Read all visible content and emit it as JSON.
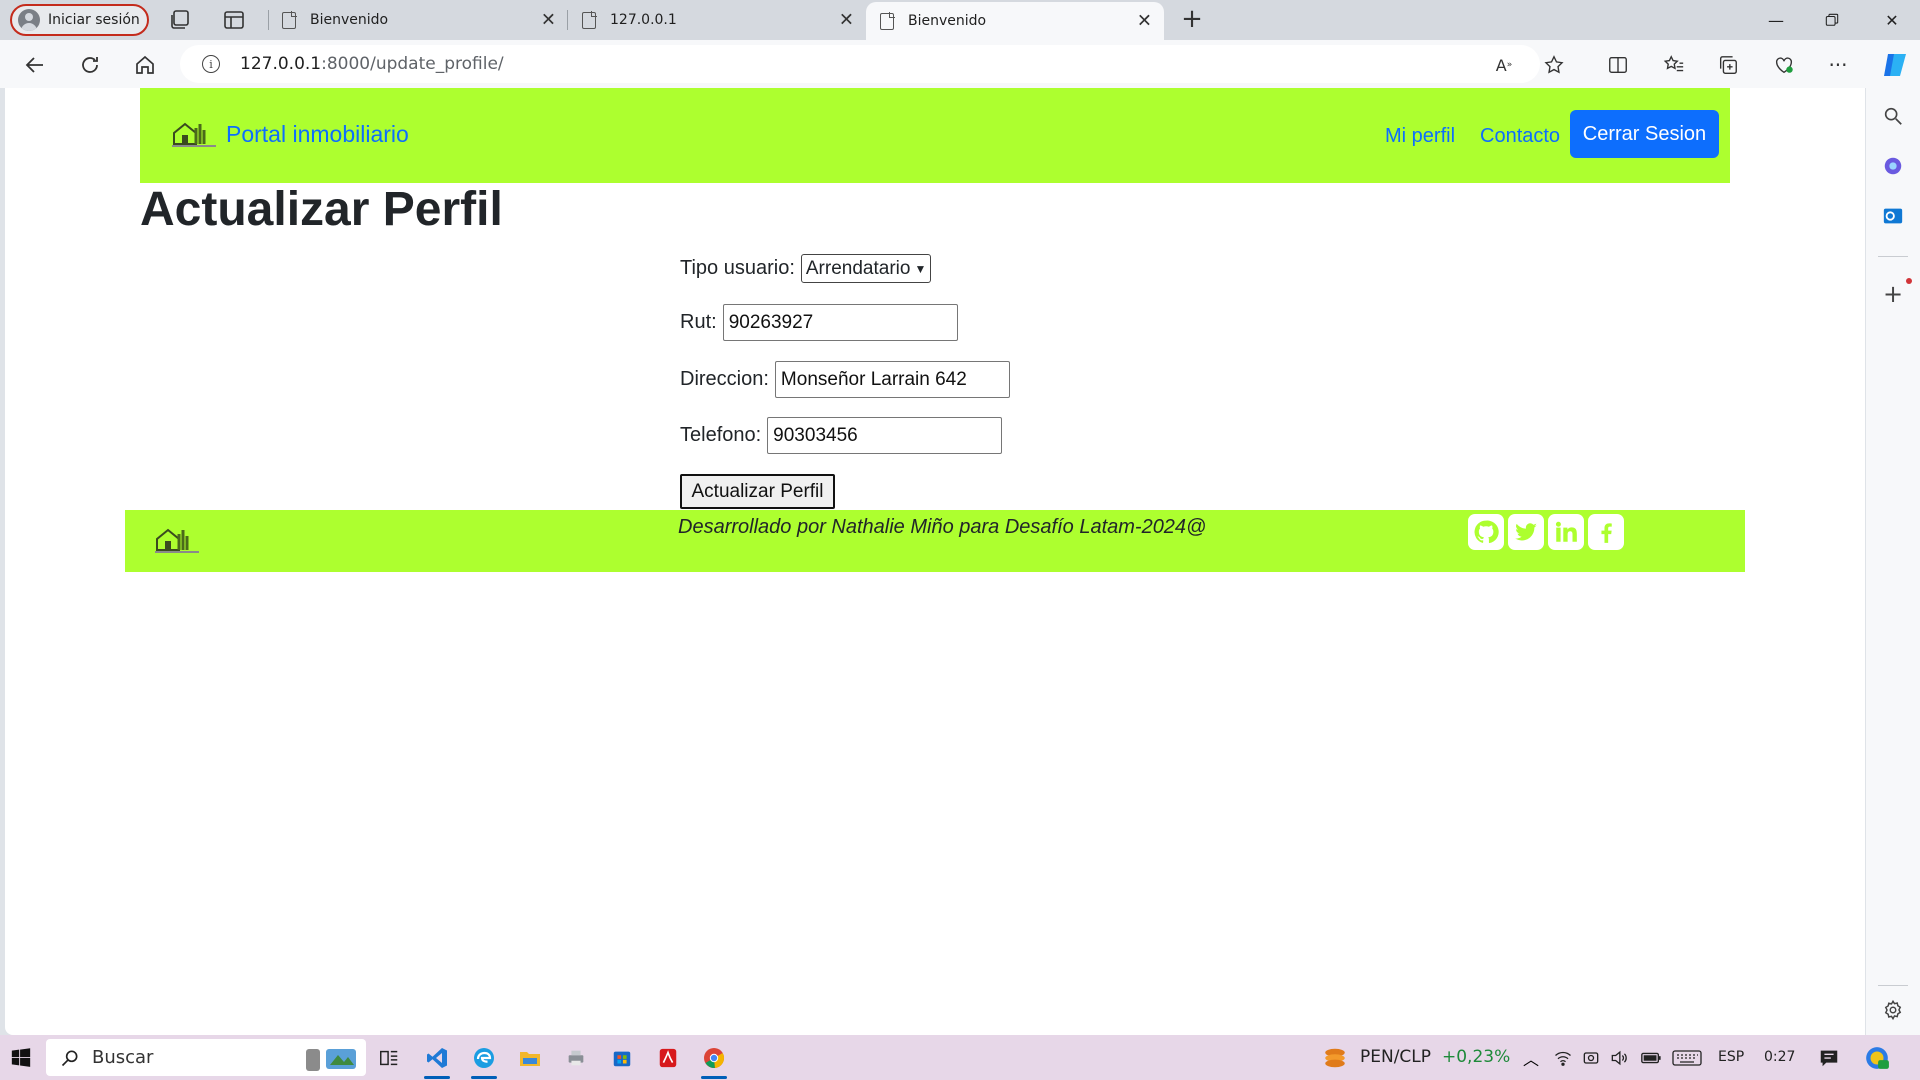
{
  "browser": {
    "profile_label": "Iniciar sesión",
    "tabs": [
      {
        "title": "Bienvenido"
      },
      {
        "title": "127.0.0.1"
      },
      {
        "title": "Bienvenido"
      }
    ],
    "address": {
      "host": "127.0.0.1",
      "path": ":8000/update_profile/"
    }
  },
  "site": {
    "brand": "Portal inmobiliario",
    "nav": {
      "profile": "Mi perfil",
      "contact": "Contacto",
      "logout": "Cerrar Sesion"
    },
    "page_title": "Actualizar Perfil",
    "form": {
      "tipo_label": "Tipo usuario:",
      "tipo_value": "Arrendatario",
      "rut_label": "Rut:",
      "rut_value": "90263927",
      "direccion_label": "Direccion:",
      "direccion_value": "Monseñor Larrain 642",
      "telefono_label": "Telefono:",
      "telefono_value": "90303456",
      "submit_label": "Actualizar Perfil"
    },
    "footer_text": "Desarrollado por Nathalie Miño para Desafío Latam-2024@",
    "colors": {
      "bar": "#adff2f",
      "link": "#0d6efd"
    }
  },
  "taskbar": {
    "search_label": "Buscar",
    "currency": "PEN/CLP",
    "currency_change": "+0,23%",
    "language": "ESP",
    "time": "0:27"
  }
}
